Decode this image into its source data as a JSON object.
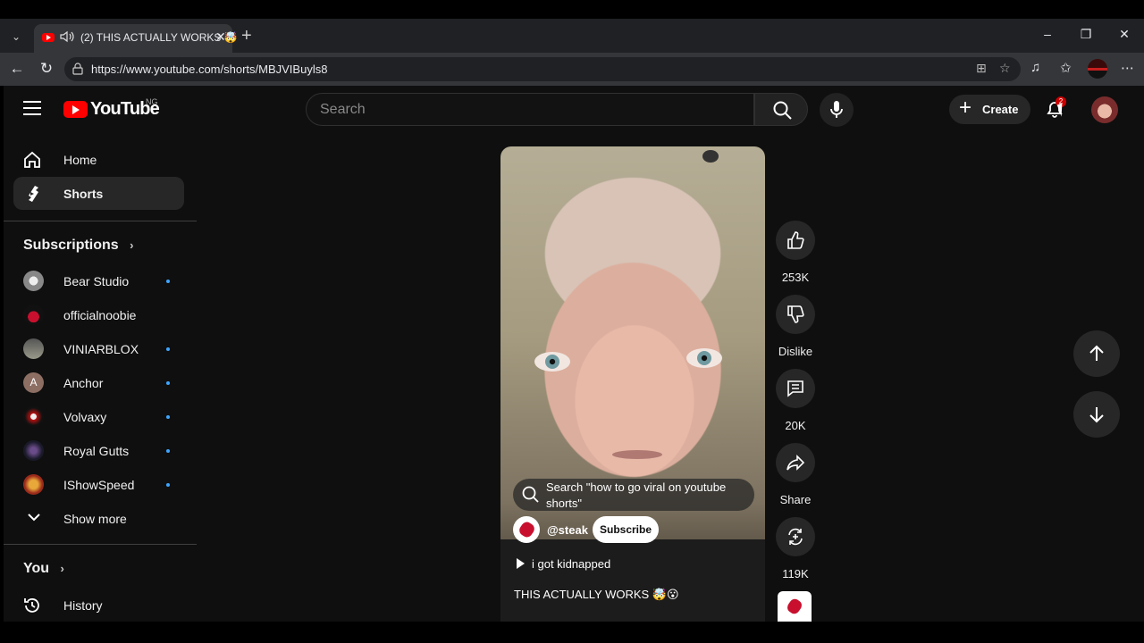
{
  "browser": {
    "tab": {
      "title": "(2) THIS ACTUALLY WORKS 🤯",
      "favicon": "youtube-favicon",
      "audio_icon": "speaker-icon"
    },
    "url": "https://www.youtube.com/shorts/MBJVIBuyls8",
    "icons": [
      "tab-list-icon",
      "close-icon",
      "plus-icon",
      "minimize-icon",
      "restore-icon",
      "back-icon",
      "reload-icon",
      "site-info-icon",
      "app-available-icon",
      "star-icon",
      "media-icon",
      "favorites-icon",
      "more-icon"
    ]
  },
  "header": {
    "logo_text": "YouTube",
    "region": "NG",
    "search_placeholder": "Search",
    "create_label": "Create",
    "notification_count": "2",
    "accent_color": "#ff0000"
  },
  "sidebar": {
    "main": [
      {
        "label": "Home",
        "icon": "home-icon"
      },
      {
        "label": "Shorts",
        "icon": "shorts-icon",
        "active": true
      }
    ],
    "subscriptions_heading": "Subscriptions",
    "subscriptions": [
      {
        "label": "Bear Studio",
        "new": true
      },
      {
        "label": "officialnoobie",
        "new": false
      },
      {
        "label": "VINIARBLOX",
        "new": true
      },
      {
        "label": "Anchor",
        "new": true,
        "initial": "A"
      },
      {
        "label": "Volvaxy",
        "new": true
      },
      {
        "label": "Royal Gutts",
        "new": true
      },
      {
        "label": "IShowSpeed",
        "new": true
      }
    ],
    "show_more": "Show more",
    "you_heading": "You",
    "history": "History",
    "new_dot_color": "#3ea6ff"
  },
  "short": {
    "search_suggestion": "Search \"how to go viral on youtube shorts\"",
    "channel": "@steak",
    "subscribe": "Subscribe",
    "sound": "i got kidnapped",
    "title": "THIS ACTUALLY WORKS 🤯😮"
  },
  "actions": {
    "likes": "253K",
    "dislike": "Dislike",
    "comments": "20K",
    "share": "Share",
    "remixes": "119K"
  }
}
